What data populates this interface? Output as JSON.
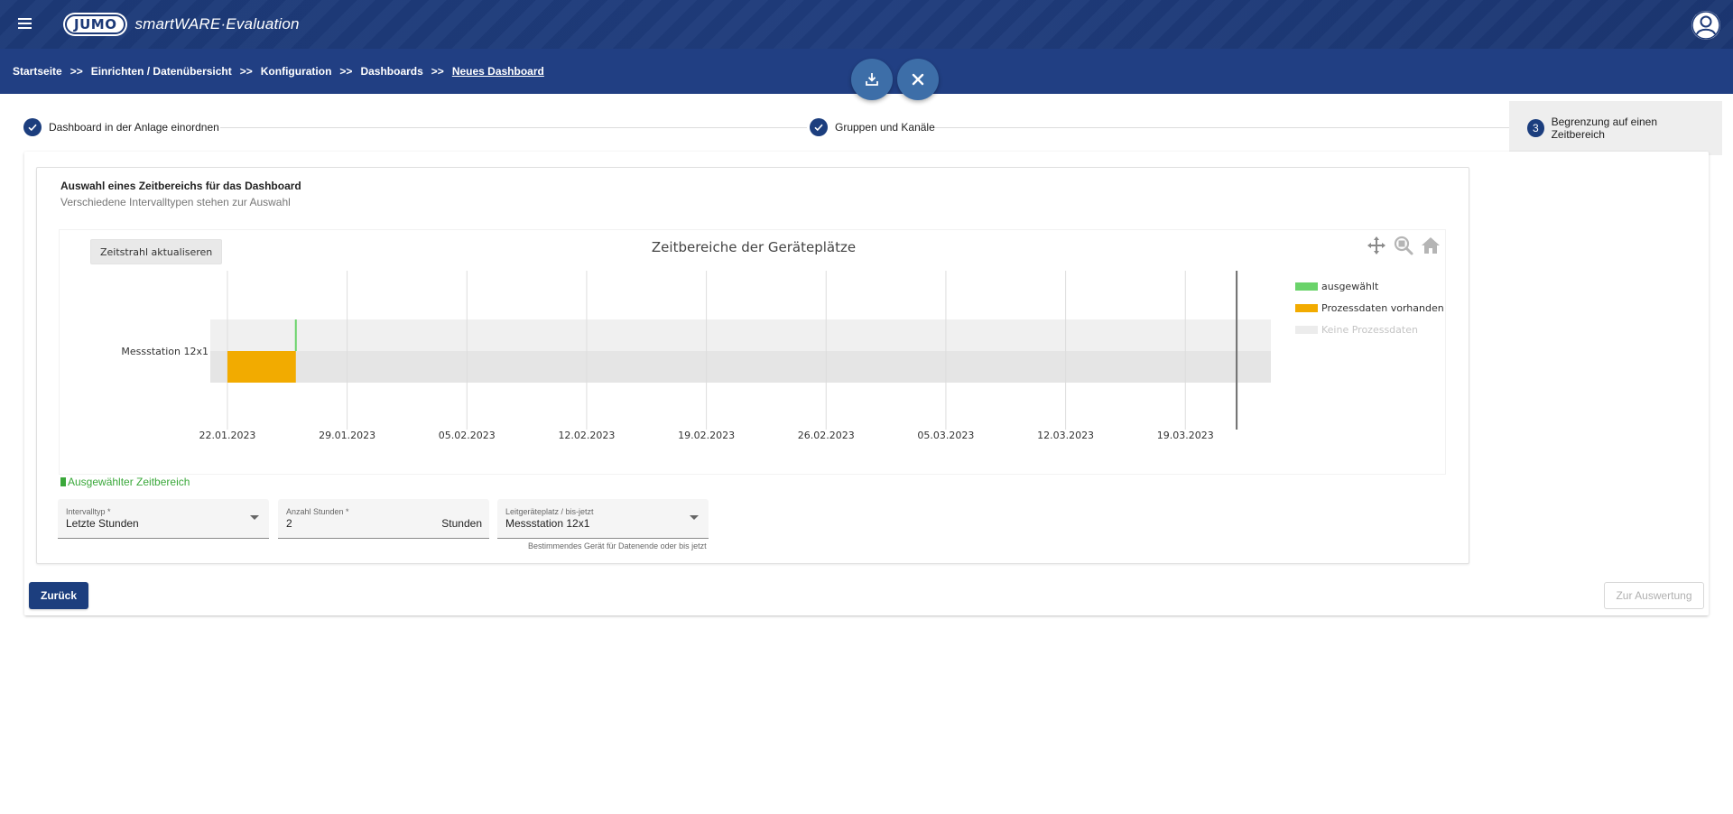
{
  "app": {
    "logo_brand": "JUMO",
    "logo_text": "smartWARE·Evaluation"
  },
  "breadcrumb": [
    {
      "label": "Startseite"
    },
    {
      "label": "Einrichten / Datenübersicht"
    },
    {
      "label": "Konfiguration"
    },
    {
      "label": "Dashboards"
    },
    {
      "label": "Neues Dashboard"
    }
  ],
  "breadcrumb_sep": ">>",
  "stepper": {
    "steps": [
      {
        "label": "Dashboard in der Anlage einordnen",
        "state": "done"
      },
      {
        "label": "Gruppen und Kanäle",
        "state": "done"
      },
      {
        "label": "Begrenzung auf einen Zeitbereich",
        "state": "active",
        "number": "3"
      }
    ]
  },
  "card": {
    "title": "Auswahl eines Zeitbereichs für das Dashboard",
    "subtitle": "Verschiedene Intervalltypen stehen zur Auswahl"
  },
  "chart": {
    "refresh_label": "Zeitstrahl aktualiseren",
    "tools": [
      "move-icon",
      "zoom-icon",
      "home-icon"
    ]
  },
  "chart_data": {
    "type": "timeline",
    "title": "Zeitbereiche der Geräteplätze",
    "categories": [
      "Messstation 12x1"
    ],
    "x_ticks": [
      "22.01.2023",
      "29.01.2023",
      "05.02.2023",
      "12.02.2023",
      "19.02.2023",
      "26.02.2023",
      "05.03.2023",
      "12.03.2023",
      "19.03.2023"
    ],
    "xlim": [
      "2023-01-21",
      "2023-03-24"
    ],
    "now_marker": "2023-03-22",
    "series": [
      {
        "name": "ausgewählt",
        "color": "#6ad36a",
        "intervals": [
          {
            "category": "Messstation 12x1",
            "start": "2023-01-26",
            "end": "2023-01-26"
          }
        ]
      },
      {
        "name": "Prozessdaten vorhanden",
        "color": "#f2ab00",
        "intervals": [
          {
            "category": "Messstation 12x1",
            "start": "2023-01-22",
            "end": "2023-01-26"
          }
        ]
      },
      {
        "name": "Keine Prozessdaten",
        "color": "#ececec",
        "intervals": []
      }
    ],
    "legend": "right"
  },
  "selection_label": "Ausgewählter Zeitbereich",
  "form": {
    "interval_type": {
      "label": "Intervalltyp *",
      "value": "Letzte Stunden"
    },
    "hours": {
      "label": "Anzahl Stunden *",
      "value": "2",
      "suffix": "Stunden"
    },
    "lead_device": {
      "label": "Leitgeräteplatz / bis-jetzt",
      "value": "Messstation 12x1",
      "hint": "Bestimmendes Gerät für Datenende oder bis jetzt"
    }
  },
  "buttons": {
    "back": "Zurück",
    "next": "Zur Auswertung"
  }
}
